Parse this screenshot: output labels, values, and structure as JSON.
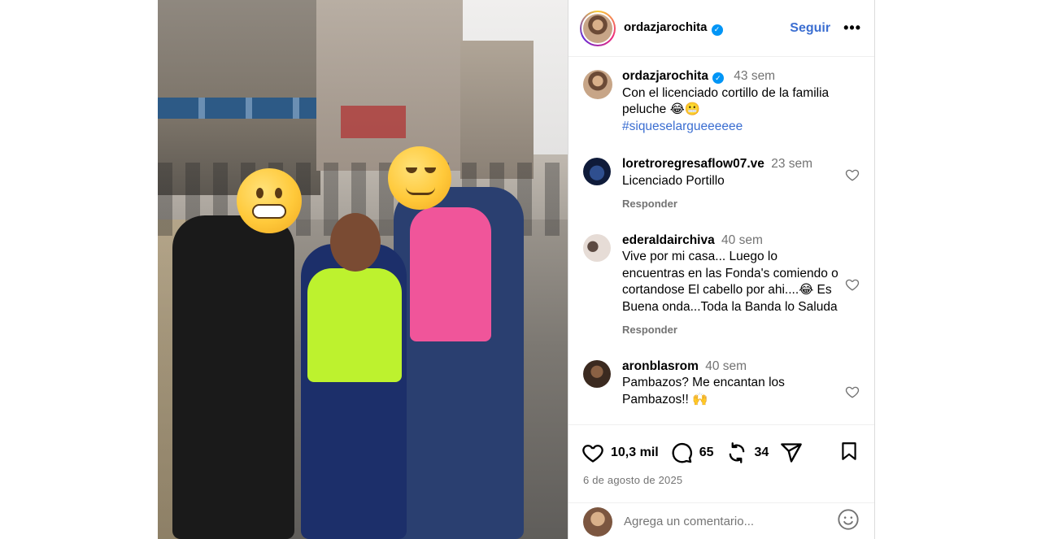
{
  "post": {
    "author": "ordazjarochita",
    "follow_label": "Seguir",
    "more_label": "•••",
    "caption": {
      "username": "ordazjarochita",
      "time": "43 sem",
      "text": "Con el licenciado cortillo de la familia peluche 😂😬",
      "hashtag": "#siqueselargueeeeee"
    },
    "likes": "10,3 mil",
    "comments_count": "65",
    "reposts_count": "34",
    "date": "6 de agosto de 2025"
  },
  "comments": [
    {
      "username": "loretroregresaflow07.ve",
      "time": "23 sem",
      "text": "Licenciado Portillo",
      "reply_label": "Responder"
    },
    {
      "username": "ederaldairchiva",
      "time": "40 sem",
      "text": "Vive por mi casa... Luego lo encuentras en las Fonda's comiendo o cortandose El cabello por ahi....😂 Es Buena onda...Toda la Banda lo Saluda",
      "reply_label": "Responder"
    },
    {
      "username": "aronblasrom",
      "time": "40 sem",
      "text": "Pambazos? Me encantan los Pambazos!! 🙌"
    }
  ],
  "add_comment": {
    "placeholder": "Agrega un comentario..."
  },
  "colors": {
    "accent": "#3b6ed1",
    "verified": "#0095f6",
    "muted": "#737373"
  },
  "icons": [
    "verified-badge-icon",
    "heart-icon",
    "comment-icon",
    "repost-icon",
    "share-icon",
    "bookmark-icon",
    "emoji-icon"
  ]
}
